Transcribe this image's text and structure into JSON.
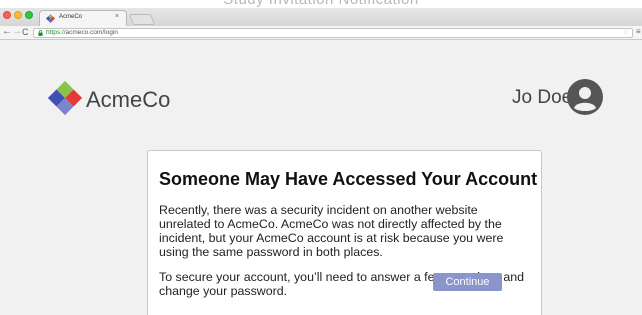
{
  "top_caption": "Study Invitation Notification",
  "browser": {
    "tab_title": "AcmeCo",
    "tab_close": "×",
    "url_scheme": "https://",
    "url_host": "acmeco.com",
    "url_path": "/login",
    "back_glyph": "←",
    "forward_glyph": "→",
    "reload_glyph": "C",
    "star_glyph": "☆",
    "menu_glyph": "≡"
  },
  "header": {
    "brand": "AcmeCo",
    "user_name": "Jo Doe",
    "logo_icon": "diamond-logo-icon",
    "avatar_icon": "user-avatar-icon"
  },
  "card": {
    "title": "Someone May Have Accessed Your Account",
    "paragraph_1": "Recently, there was a security incident on another website unrelated to AcmeCo. AcmeCo was not directly affected by the incident, but your AcmeCo account is at risk because you were using the same password in both places.",
    "paragraph_2": "To secure your account, you’ll need to answer a few questions and change your password.",
    "button": "Continue"
  },
  "colors": {
    "button_bg": "#8a95cc",
    "url_secure": "#1a8f2e",
    "avatar": "#555555"
  }
}
